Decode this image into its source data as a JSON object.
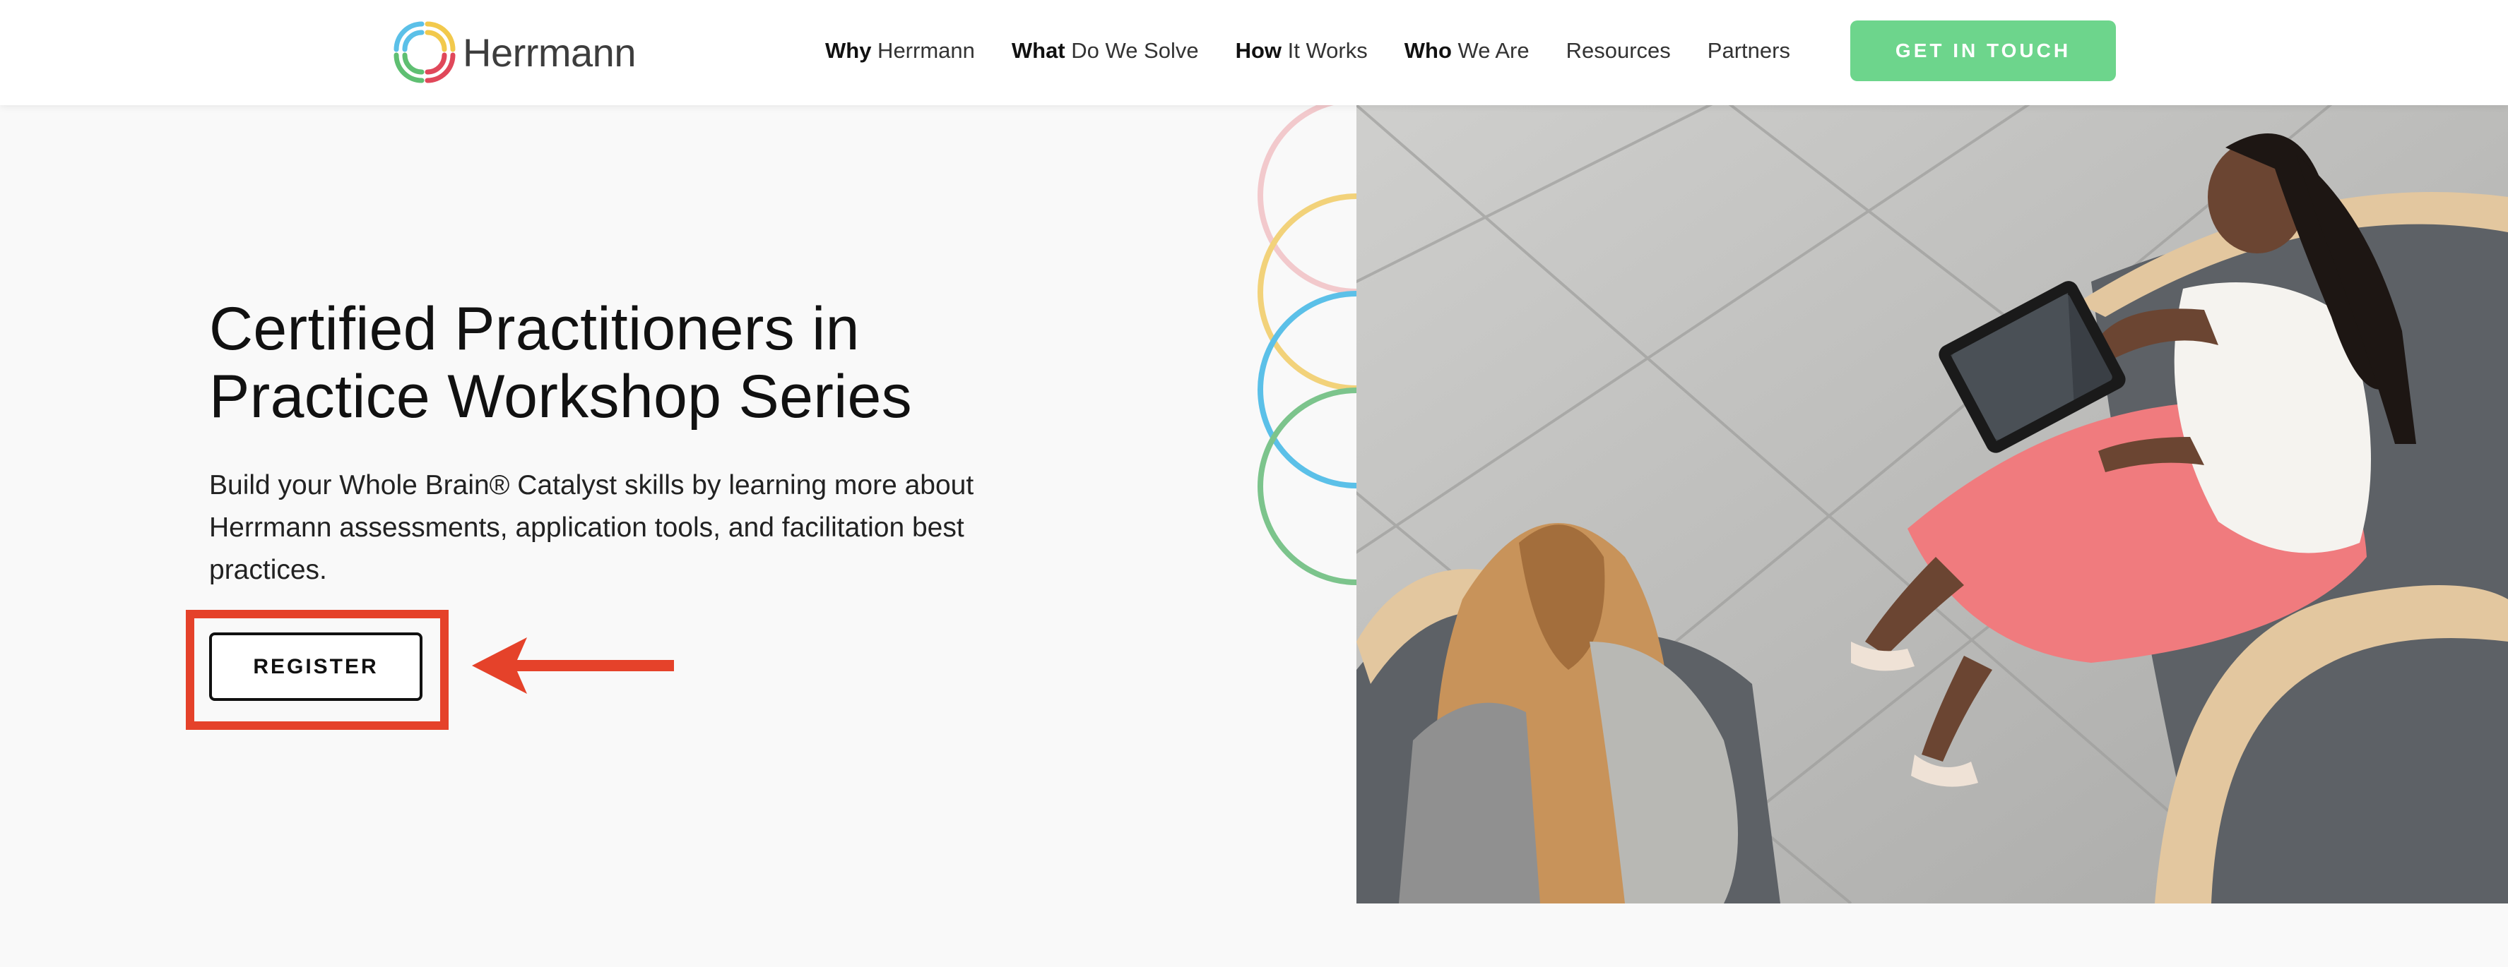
{
  "header": {
    "logo_text": "Herrmann",
    "nav": [
      {
        "bold": "Why",
        "rest": " Herrmann"
      },
      {
        "bold": "What",
        "rest": " Do We Solve"
      },
      {
        "bold": "How",
        "rest": " It Works"
      },
      {
        "bold": "Who",
        "rest": " We Are"
      },
      {
        "bold": "",
        "rest": "Resources"
      },
      {
        "bold": "",
        "rest": "Partners"
      }
    ],
    "cta_label": "GET IN TOUCH"
  },
  "hero": {
    "title_line1": "Certified Practitioners in",
    "title_line2": "Practice Workshop Series",
    "body": "Build your Whole Brain® Catalyst skills by learning more about Herrmann assessments, application tools, and facilitation best practices.",
    "register_label": "REGISTER"
  },
  "colors": {
    "accent_green": "#6dd58c",
    "annotation_red": "#e5422a",
    "circle_pink": "#f2c9cc",
    "circle_yellow": "#f2d27a",
    "circle_blue": "#5bc0e8",
    "circle_green": "#7cc48c"
  }
}
